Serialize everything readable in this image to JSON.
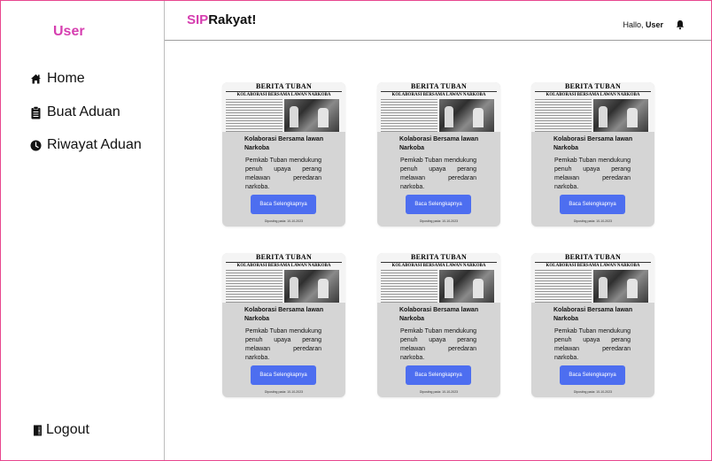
{
  "sidebar": {
    "user": "User",
    "items": [
      {
        "label": "Home",
        "icon": "home-icon"
      },
      {
        "label": "Buat Aduan",
        "icon": "clipboard-icon"
      },
      {
        "label": "Riwayat Aduan",
        "icon": "clock-icon"
      }
    ],
    "logout": {
      "label": "Logout",
      "icon": "logout-icon"
    }
  },
  "header": {
    "brand_accent": "SIP",
    "brand_rest": "Rakyat!",
    "greeting": "Hallo,",
    "username": "User",
    "bell_icon": "bell-icon"
  },
  "colors": {
    "accent_pink": "#d63fb0",
    "button_blue": "#4d6ef0",
    "card_bg": "#d5d5d5",
    "frame_border": "#e8468e"
  },
  "cards": [
    {
      "paper_header": "BERITA TUBAN",
      "paper_headline": "KOLABORASI BERSAMA LAWAN NARKOBA",
      "title": "Kolaborasi Bersama lawan Narkoba",
      "description": "Pemkab Tuban mendukung penuh upaya perang melawan peredaran narkoba.",
      "button": "Baca Selengkapnya",
      "date": "Diposting pada: 10-10-2023"
    },
    {
      "paper_header": "BERITA TUBAN",
      "paper_headline": "KOLABORASI BERSAMA LAWAN NARKOBA",
      "title": "Kolaborasi Bersama lawan Narkoba",
      "description": "Pemkab Tuban mendukung penuh upaya perang melawan peredaran narkoba.",
      "button": "Baca Selengkapnya",
      "date": "Diposting pada: 10-10-2023"
    },
    {
      "paper_header": "BERITA TUBAN",
      "paper_headline": "KOLABORASI BERSAMA LAWAN NARKOBA",
      "title": "Kolaborasi Bersama lawan Narkoba",
      "description": "Pemkab Tuban mendukung penuh upaya perang melawan peredaran narkoba.",
      "button": "Baca Selengkapnya",
      "date": "Diposting pada: 10-10-2023"
    },
    {
      "paper_header": "BERITA TUBAN",
      "paper_headline": "KOLABORASI BERSAMA LAWAN NARKOBA",
      "title": "Kolaborasi Bersama lawan Narkoba",
      "description": "Pemkab Tuban mendukung penuh upaya perang melawan peredaran narkoba.",
      "button": "Baca Selengkapnya",
      "date": "Diposting pada: 10-10-2023"
    },
    {
      "paper_header": "BERITA TUBAN",
      "paper_headline": "KOLABORASI BERSAMA LAWAN NARKOBA",
      "title": "Kolaborasi Bersama lawan Narkoba",
      "description": "Pemkab Tuban mendukung penuh upaya perang melawan peredaran narkoba.",
      "button": "Baca Selengkapnya",
      "date": "Diposting pada: 10-10-2023"
    },
    {
      "paper_header": "BERITA TUBAN",
      "paper_headline": "KOLABORASI BERSAMA LAWAN NARKOBA",
      "title": "Kolaborasi Bersama lawan Narkoba",
      "description": "Pemkab Tuban mendukung penuh upaya perang melawan peredaran narkoba.",
      "button": "Baca Selengkapnya",
      "date": "Diposting pada: 10-10-2023"
    }
  ]
}
